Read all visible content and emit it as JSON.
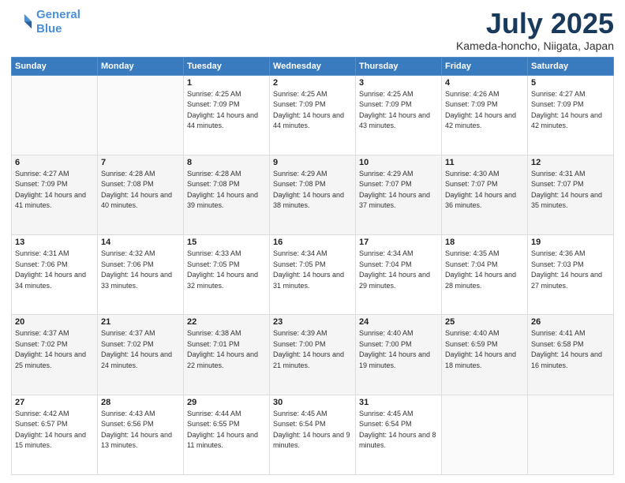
{
  "header": {
    "logo_line1": "General",
    "logo_line2": "Blue",
    "month": "July 2025",
    "location": "Kameda-honcho, Niigata, Japan"
  },
  "weekdays": [
    "Sunday",
    "Monday",
    "Tuesday",
    "Wednesday",
    "Thursday",
    "Friday",
    "Saturday"
  ],
  "weeks": [
    [
      {
        "day": "",
        "sunrise": "",
        "sunset": "",
        "daylight": ""
      },
      {
        "day": "",
        "sunrise": "",
        "sunset": "",
        "daylight": ""
      },
      {
        "day": "1",
        "sunrise": "Sunrise: 4:25 AM",
        "sunset": "Sunset: 7:09 PM",
        "daylight": "Daylight: 14 hours and 44 minutes."
      },
      {
        "day": "2",
        "sunrise": "Sunrise: 4:25 AM",
        "sunset": "Sunset: 7:09 PM",
        "daylight": "Daylight: 14 hours and 44 minutes."
      },
      {
        "day": "3",
        "sunrise": "Sunrise: 4:25 AM",
        "sunset": "Sunset: 7:09 PM",
        "daylight": "Daylight: 14 hours and 43 minutes."
      },
      {
        "day": "4",
        "sunrise": "Sunrise: 4:26 AM",
        "sunset": "Sunset: 7:09 PM",
        "daylight": "Daylight: 14 hours and 42 minutes."
      },
      {
        "day": "5",
        "sunrise": "Sunrise: 4:27 AM",
        "sunset": "Sunset: 7:09 PM",
        "daylight": "Daylight: 14 hours and 42 minutes."
      }
    ],
    [
      {
        "day": "6",
        "sunrise": "Sunrise: 4:27 AM",
        "sunset": "Sunset: 7:09 PM",
        "daylight": "Daylight: 14 hours and 41 minutes."
      },
      {
        "day": "7",
        "sunrise": "Sunrise: 4:28 AM",
        "sunset": "Sunset: 7:08 PM",
        "daylight": "Daylight: 14 hours and 40 minutes."
      },
      {
        "day": "8",
        "sunrise": "Sunrise: 4:28 AM",
        "sunset": "Sunset: 7:08 PM",
        "daylight": "Daylight: 14 hours and 39 minutes."
      },
      {
        "day": "9",
        "sunrise": "Sunrise: 4:29 AM",
        "sunset": "Sunset: 7:08 PM",
        "daylight": "Daylight: 14 hours and 38 minutes."
      },
      {
        "day": "10",
        "sunrise": "Sunrise: 4:29 AM",
        "sunset": "Sunset: 7:07 PM",
        "daylight": "Daylight: 14 hours and 37 minutes."
      },
      {
        "day": "11",
        "sunrise": "Sunrise: 4:30 AM",
        "sunset": "Sunset: 7:07 PM",
        "daylight": "Daylight: 14 hours and 36 minutes."
      },
      {
        "day": "12",
        "sunrise": "Sunrise: 4:31 AM",
        "sunset": "Sunset: 7:07 PM",
        "daylight": "Daylight: 14 hours and 35 minutes."
      }
    ],
    [
      {
        "day": "13",
        "sunrise": "Sunrise: 4:31 AM",
        "sunset": "Sunset: 7:06 PM",
        "daylight": "Daylight: 14 hours and 34 minutes."
      },
      {
        "day": "14",
        "sunrise": "Sunrise: 4:32 AM",
        "sunset": "Sunset: 7:06 PM",
        "daylight": "Daylight: 14 hours and 33 minutes."
      },
      {
        "day": "15",
        "sunrise": "Sunrise: 4:33 AM",
        "sunset": "Sunset: 7:05 PM",
        "daylight": "Daylight: 14 hours and 32 minutes."
      },
      {
        "day": "16",
        "sunrise": "Sunrise: 4:34 AM",
        "sunset": "Sunset: 7:05 PM",
        "daylight": "Daylight: 14 hours and 31 minutes."
      },
      {
        "day": "17",
        "sunrise": "Sunrise: 4:34 AM",
        "sunset": "Sunset: 7:04 PM",
        "daylight": "Daylight: 14 hours and 29 minutes."
      },
      {
        "day": "18",
        "sunrise": "Sunrise: 4:35 AM",
        "sunset": "Sunset: 7:04 PM",
        "daylight": "Daylight: 14 hours and 28 minutes."
      },
      {
        "day": "19",
        "sunrise": "Sunrise: 4:36 AM",
        "sunset": "Sunset: 7:03 PM",
        "daylight": "Daylight: 14 hours and 27 minutes."
      }
    ],
    [
      {
        "day": "20",
        "sunrise": "Sunrise: 4:37 AM",
        "sunset": "Sunset: 7:02 PM",
        "daylight": "Daylight: 14 hours and 25 minutes."
      },
      {
        "day": "21",
        "sunrise": "Sunrise: 4:37 AM",
        "sunset": "Sunset: 7:02 PM",
        "daylight": "Daylight: 14 hours and 24 minutes."
      },
      {
        "day": "22",
        "sunrise": "Sunrise: 4:38 AM",
        "sunset": "Sunset: 7:01 PM",
        "daylight": "Daylight: 14 hours and 22 minutes."
      },
      {
        "day": "23",
        "sunrise": "Sunrise: 4:39 AM",
        "sunset": "Sunset: 7:00 PM",
        "daylight": "Daylight: 14 hours and 21 minutes."
      },
      {
        "day": "24",
        "sunrise": "Sunrise: 4:40 AM",
        "sunset": "Sunset: 7:00 PM",
        "daylight": "Daylight: 14 hours and 19 minutes."
      },
      {
        "day": "25",
        "sunrise": "Sunrise: 4:40 AM",
        "sunset": "Sunset: 6:59 PM",
        "daylight": "Daylight: 14 hours and 18 minutes."
      },
      {
        "day": "26",
        "sunrise": "Sunrise: 4:41 AM",
        "sunset": "Sunset: 6:58 PM",
        "daylight": "Daylight: 14 hours and 16 minutes."
      }
    ],
    [
      {
        "day": "27",
        "sunrise": "Sunrise: 4:42 AM",
        "sunset": "Sunset: 6:57 PM",
        "daylight": "Daylight: 14 hours and 15 minutes."
      },
      {
        "day": "28",
        "sunrise": "Sunrise: 4:43 AM",
        "sunset": "Sunset: 6:56 PM",
        "daylight": "Daylight: 14 hours and 13 minutes."
      },
      {
        "day": "29",
        "sunrise": "Sunrise: 4:44 AM",
        "sunset": "Sunset: 6:55 PM",
        "daylight": "Daylight: 14 hours and 11 minutes."
      },
      {
        "day": "30",
        "sunrise": "Sunrise: 4:45 AM",
        "sunset": "Sunset: 6:54 PM",
        "daylight": "Daylight: 14 hours and 9 minutes."
      },
      {
        "day": "31",
        "sunrise": "Sunrise: 4:45 AM",
        "sunset": "Sunset: 6:54 PM",
        "daylight": "Daylight: 14 hours and 8 minutes."
      },
      {
        "day": "",
        "sunrise": "",
        "sunset": "",
        "daylight": ""
      },
      {
        "day": "",
        "sunrise": "",
        "sunset": "",
        "daylight": ""
      }
    ]
  ]
}
